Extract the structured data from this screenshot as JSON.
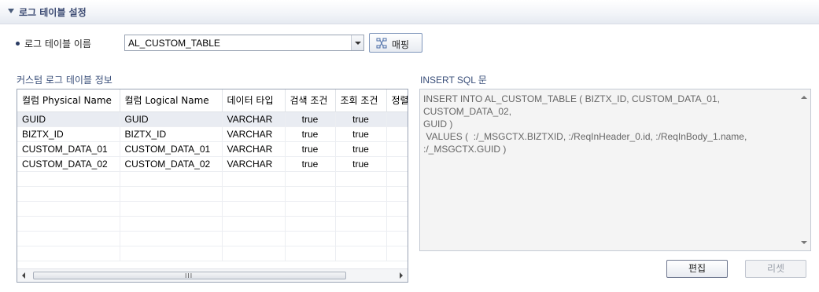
{
  "section": {
    "title": "로그 테이블 설정"
  },
  "log_table": {
    "label": "로그 테이블 이름",
    "selected": "AL_CUSTOM_TABLE",
    "mapping_button": "매핑",
    "mapping_icon": "mapping-icon"
  },
  "table_info": {
    "label": "커스텀 로그 테이블 정보",
    "columns": [
      "컬럼 Physical Name",
      "컬럼 Logical Name",
      "데이터 타입",
      "검색 조건",
      "조회 조건",
      "정렬"
    ],
    "rows": [
      [
        "GUID",
        "GUID",
        "VARCHAR",
        "true",
        "true",
        ""
      ],
      [
        "BIZTX_ID",
        "BIZTX_ID",
        "VARCHAR",
        "true",
        "true",
        ""
      ],
      [
        "CUSTOM_DATA_01",
        "CUSTOM_DATA_01",
        "VARCHAR",
        "true",
        "true",
        ""
      ],
      [
        "CUSTOM_DATA_02",
        "CUSTOM_DATA_02",
        "VARCHAR",
        "true",
        "true",
        ""
      ]
    ],
    "scroll_grip": "III"
  },
  "sql": {
    "label": "INSERT SQL 문",
    "text": "INSERT INTO AL_CUSTOM_TABLE ( BIZTX_ID, CUSTOM_DATA_01, CUSTOM_DATA_02,\nGUID )\n VALUES (  :/_MSGCTX.BIZTXID, :/ReqInHeader_0.id, :/ReqInBody_1.name,\n:/_MSGCTX.GUID )"
  },
  "buttons": {
    "edit": "편집",
    "reset": "리셋"
  }
}
